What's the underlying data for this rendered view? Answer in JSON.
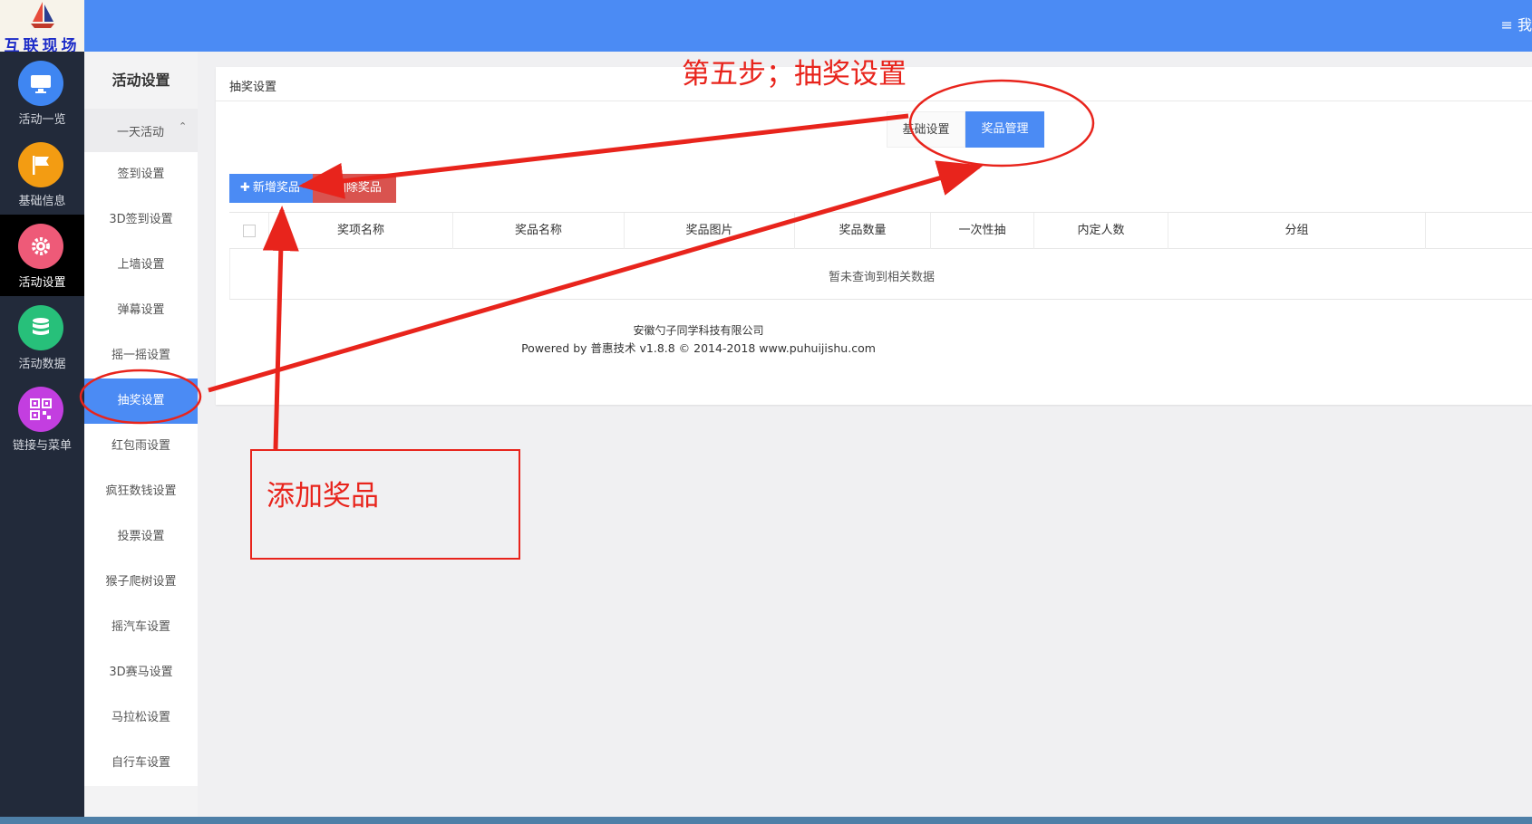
{
  "header": {
    "logo_text": "互联现场",
    "right_text": "≡ 我"
  },
  "rail": {
    "items": [
      {
        "label": "活动一览",
        "icon": "monitor-icon",
        "color": "#3f86f2"
      },
      {
        "label": "基础信息",
        "icon": "flag-icon",
        "color": "#f39c12"
      },
      {
        "label": "活动设置",
        "icon": "gear-icon",
        "color": "#ee5a78"
      },
      {
        "label": "活动数据",
        "icon": "database-icon",
        "color": "#27c07a"
      },
      {
        "label": "链接与菜单",
        "icon": "qrcode-icon",
        "color": "#c33ee0"
      }
    ]
  },
  "submenu": {
    "title": "活动设置",
    "group_label": "一天活动",
    "group_caret": "⌃",
    "items": [
      "签到设置",
      "3D签到设置",
      "上墙设置",
      "弹幕设置",
      "摇一摇设置",
      "抽奖设置",
      "红包雨设置",
      "疯狂数钱设置",
      "投票设置",
      "猴子爬树设置",
      "摇汽车设置",
      "3D赛马设置",
      "马拉松设置",
      "自行车设置"
    ],
    "active_item": "抽奖设置"
  },
  "panel": {
    "title": "抽奖设置",
    "tabs": [
      "基础设置",
      "奖品管理"
    ],
    "active_tab": "奖品管理",
    "add_button": "新增奖品",
    "add_icon": "✚",
    "delete_button": "删除奖品",
    "delete_icon": "▪",
    "columns": [
      "奖项名称",
      "奖品名称",
      "奖品图片",
      "奖品数量",
      "一次性抽",
      "内定人数",
      "分组"
    ],
    "empty_text": "暂未查询到相关数据",
    "footer_company": "安徽勺子同学科技有限公司",
    "footer_powered": "Powered by 普惠技术 v1.8.8 © 2014-2018 www.puhuijishu.com"
  },
  "annotations": {
    "step_title": "第五步；抽奖设置",
    "box_text": "添加奖品",
    "color": "#e8241c"
  }
}
